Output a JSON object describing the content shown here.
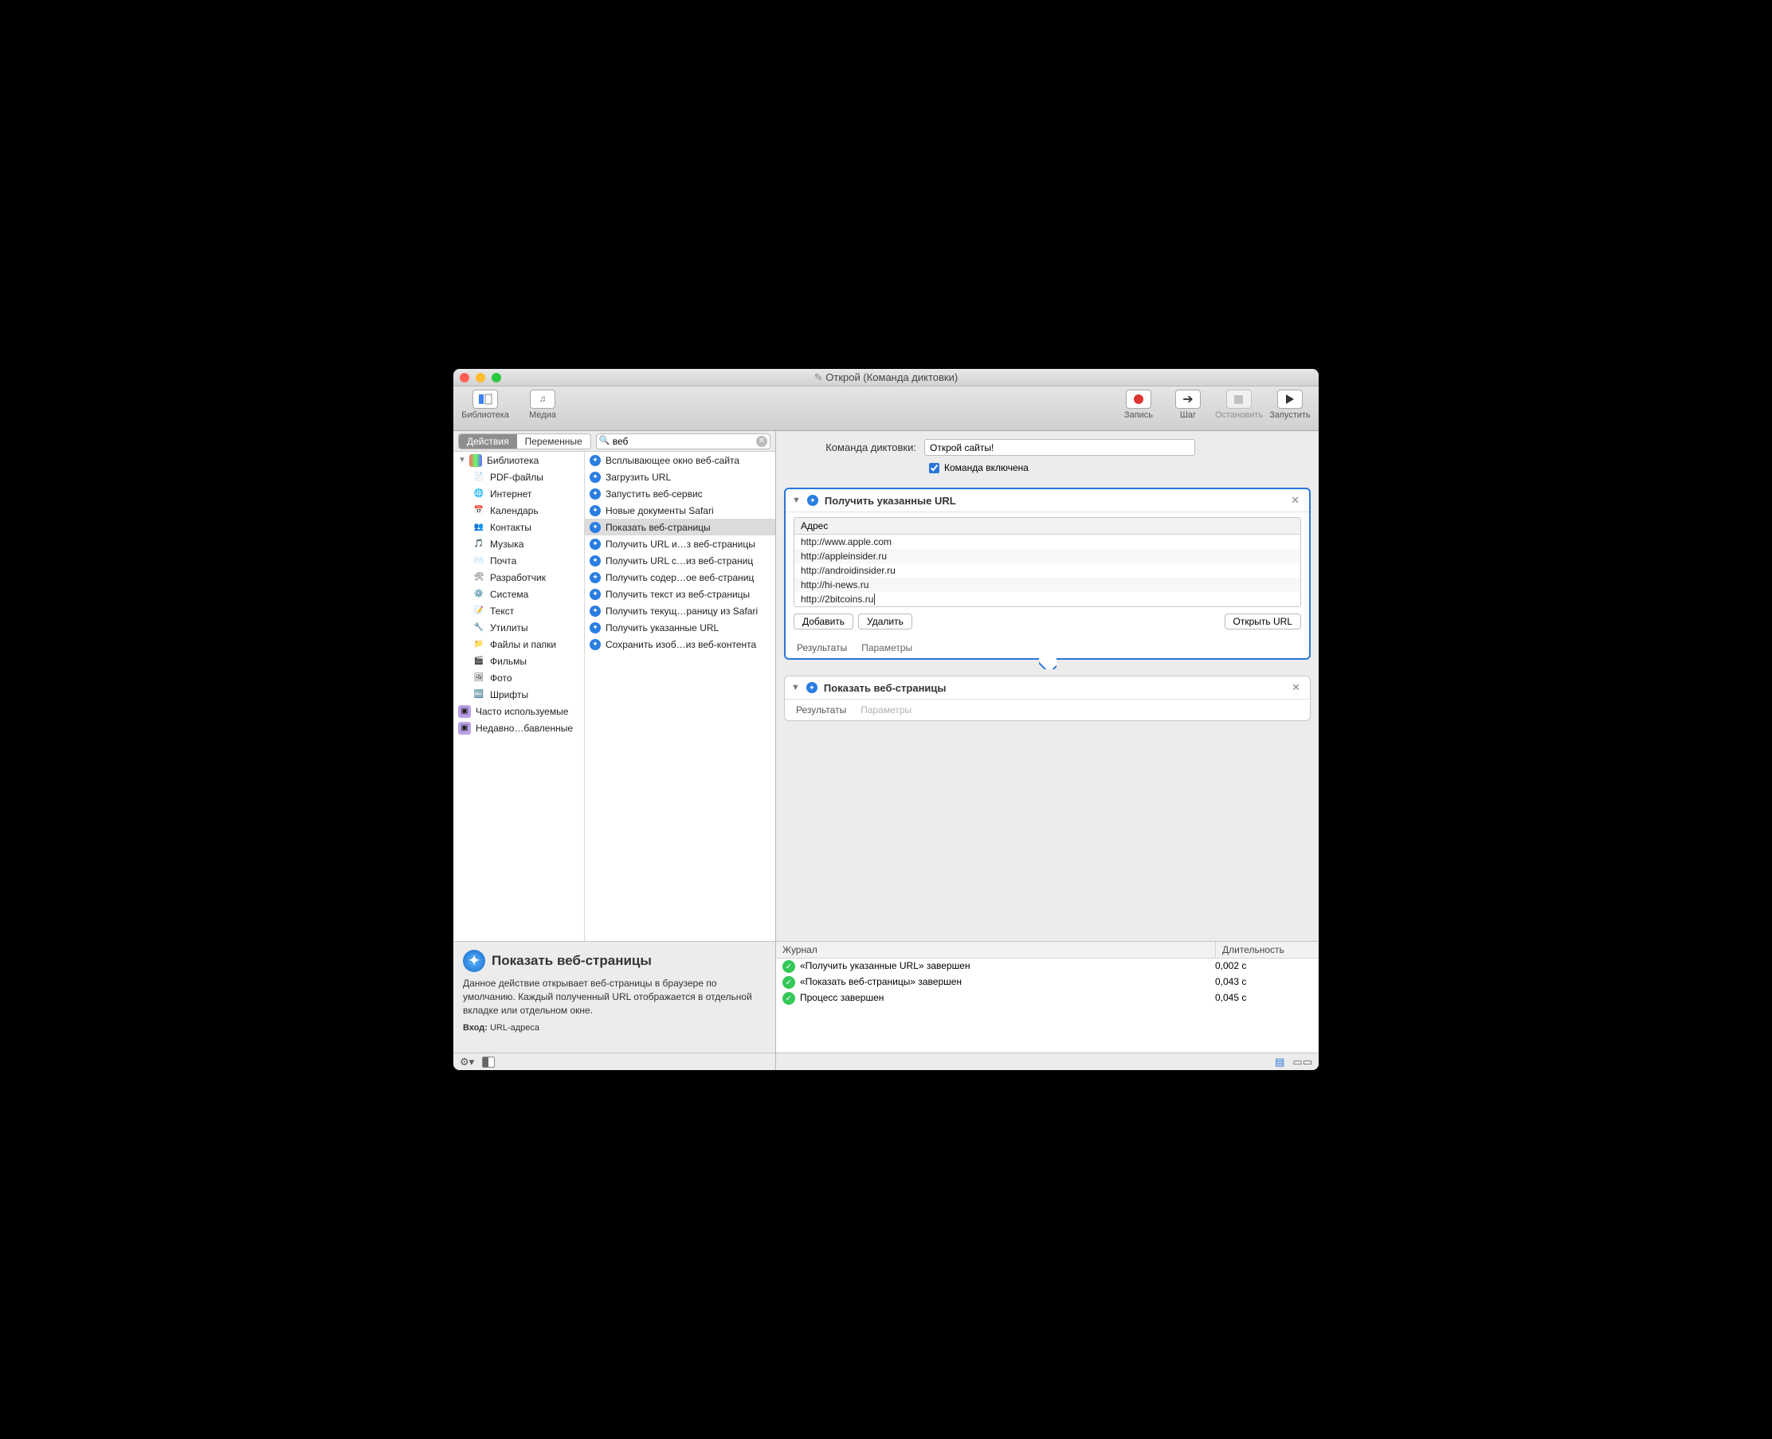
{
  "window_title": "Открой (Команда диктовки)",
  "toolbar": {
    "library": "Библиотека",
    "media": "Медиа",
    "record": "Запись",
    "step": "Шаг",
    "stop": "Остановить",
    "run": "Запустить"
  },
  "tabs": {
    "actions": "Действия",
    "variables": "Переменные"
  },
  "search_value": "веб",
  "library_root": "Библиотека",
  "library_items": [
    "PDF-файлы",
    "Интернет",
    "Календарь",
    "Контакты",
    "Музыка",
    "Почта",
    "Разработчик",
    "Система",
    "Текст",
    "Утилиты",
    "Файлы и папки",
    "Фильмы",
    "Фото",
    "Шрифты"
  ],
  "library_folders": [
    "Часто используемые",
    "Недавно…бавленные"
  ],
  "actions": [
    "Всплывающее окно веб-сайта",
    "Загрузить URL",
    "Запустить веб-сервис",
    "Новые документы Safari",
    "Показать веб-страницы",
    "Получить URL и…з веб-страницы",
    "Получить URL с…из веб-страниц",
    "Получить содер…ое веб-страниц",
    "Получить текст из веб-страницы",
    "Получить текущ…раницу из Safari",
    "Получить указанные URL",
    "Сохранить изоб…из веб-контента"
  ],
  "selected_action_index": 4,
  "info": {
    "title": "Показать веб-страницы",
    "desc": "Данное действие открывает веб-страницы в браузере по умолчанию. Каждый полученный URL отображается в отдельной вкладке или отдельном окне.",
    "input_label": "Вход:",
    "input_value": "URL-адреса"
  },
  "command": {
    "label": "Команда диктовки:",
    "value": "Открой сайты!",
    "enabled_label": "Команда включена",
    "enabled": true
  },
  "card1": {
    "title": "Получить указанные URL",
    "address_header": "Адрес",
    "urls": [
      "http://www.apple.com",
      "http://appleinsider.ru",
      "http://androidinsider.ru",
      "http://hi-news.ru",
      "http://2bitcoins.ru"
    ],
    "add": "Добавить",
    "delete": "Удалить",
    "open": "Открыть URL",
    "results": "Результаты",
    "params": "Параметры"
  },
  "card2": {
    "title": "Показать веб-страницы",
    "results": "Результаты",
    "params": "Параметры"
  },
  "log": {
    "journal": "Журнал",
    "duration": "Длительность",
    "rows": [
      {
        "msg": "«Получить указанные URL» завершен",
        "dur": "0,002 с"
      },
      {
        "msg": "«Показать веб-страницы» завершен",
        "dur": "0,043 с"
      },
      {
        "msg": "Процесс завершен",
        "dur": "0,045 с"
      }
    ]
  }
}
